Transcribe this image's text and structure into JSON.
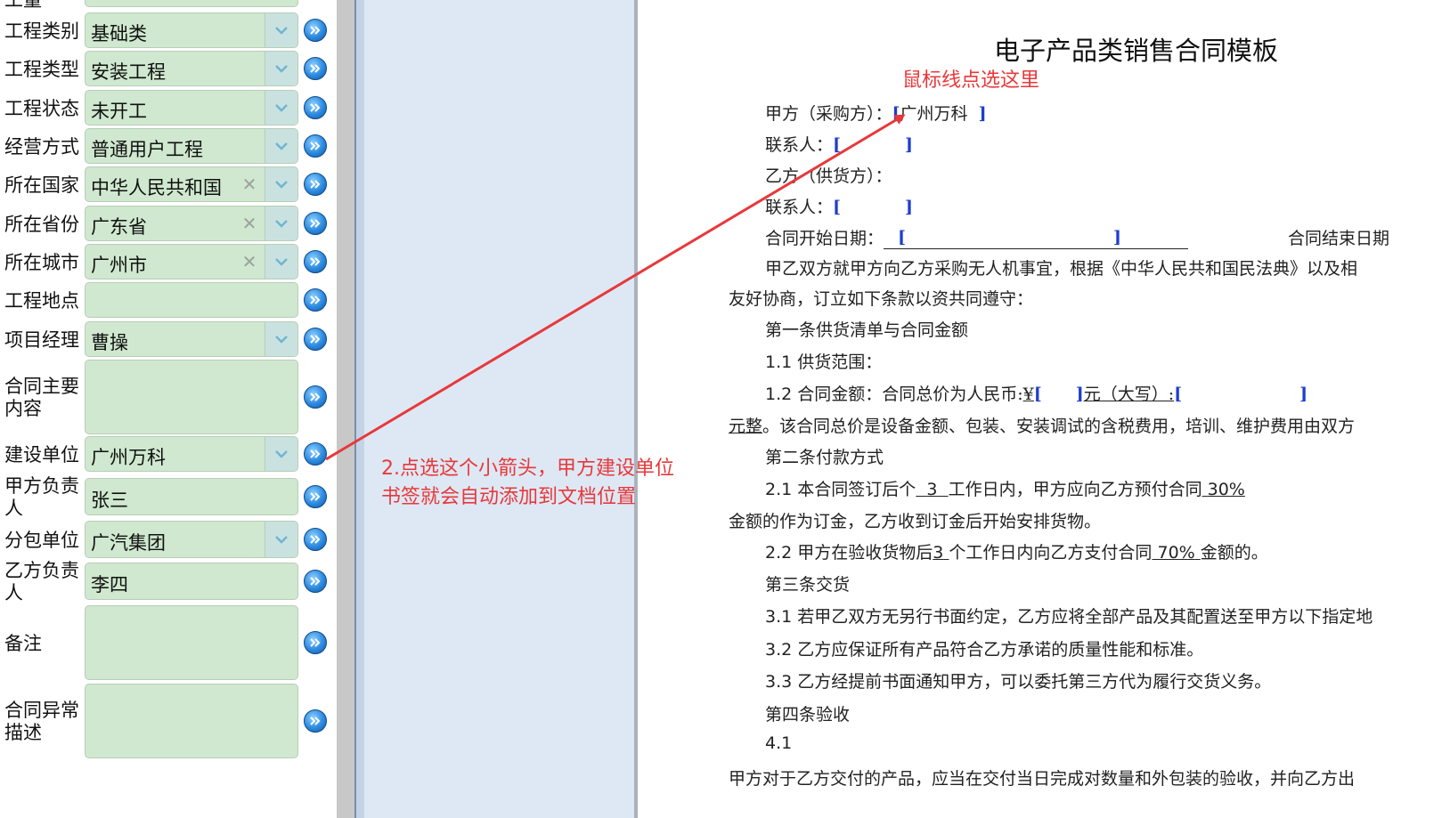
{
  "form": {
    "top_partial_label": "工量",
    "rows": [
      {
        "id": "project-category",
        "label": "工程类别",
        "value": "基础类",
        "dropdown": true,
        "clear": false
      },
      {
        "id": "project-type",
        "label": "工程类型",
        "value": "安装工程",
        "dropdown": true,
        "clear": false
      },
      {
        "id": "project-status",
        "label": "工程状态",
        "value": "未开工",
        "dropdown": true,
        "clear": false
      },
      {
        "id": "business-mode",
        "label": "经营方式",
        "value": "普通用户工程",
        "dropdown": true,
        "clear": false
      },
      {
        "id": "country",
        "label": "所在国家",
        "value": "中华人民共和国",
        "dropdown": true,
        "clear": true
      },
      {
        "id": "province",
        "label": "所在省份",
        "value": "广东省",
        "dropdown": true,
        "clear": true
      },
      {
        "id": "city",
        "label": "所在城市",
        "value": "广州市",
        "dropdown": true,
        "clear": true
      },
      {
        "id": "project-location",
        "label": "工程地点",
        "value": "",
        "dropdown": false,
        "clear": false
      },
      {
        "id": "project-manager",
        "label": "项目经理",
        "value": "曹操",
        "dropdown": true,
        "clear": false
      },
      {
        "id": "contract-main-content",
        "label": "合同主要内容",
        "value": "",
        "dropdown": false,
        "clear": false
      },
      {
        "id": "construction-unit",
        "label": "建设单位",
        "value": "广州万科",
        "dropdown": true,
        "clear": false
      },
      {
        "id": "party-a-person",
        "label": "甲方负责人",
        "value": "张三",
        "dropdown": false,
        "clear": false
      },
      {
        "id": "subcontract-unit",
        "label": "分包单位",
        "value": "广汽集团",
        "dropdown": true,
        "clear": false
      },
      {
        "id": "party-b-person",
        "label": "乙方负责人",
        "value": "李四",
        "dropdown": false,
        "clear": false
      },
      {
        "id": "remarks",
        "label": "备注",
        "value": "",
        "dropdown": false,
        "clear": false
      },
      {
        "id": "contract-exception",
        "label": "合同异常描述",
        "value": "",
        "dropdown": false,
        "clear": false
      }
    ]
  },
  "document": {
    "title": "电子产品类销售合同模板",
    "party_a_label": "甲方（采购方）：",
    "party_a_value": "广州万科",
    "contact1_label": "联系人：",
    "party_b_label": "乙方（供货方）：",
    "contact2_label": "联系人：",
    "start_date_label": "合同开始日期：",
    "end_date_label": "合同结束日期",
    "intro_1": "甲乙双方就甲方向乙方采购无人机事宜，根据《中华人民共和国民法典》以及相",
    "intro_2": "友好协商，订立如下条款以资共同遵守：",
    "art1": "第一条供货清单与合同金额",
    "s1_1_num": "1.1",
    "s1_1": "供货范围：",
    "s1_2_num": "1.2",
    "s1_2_a": "合同金额：合同总价为人民币:",
    "s1_2_yen": "¥",
    "s1_2_b": "元（大写）:",
    "s1_2_c1": "元整",
    "s1_2_c2": "。该合同总价是设备金额、包装、安装调试的含税费用，培训、维护费用由双方",
    "art2": "第二条付款方式",
    "s2_1_num": "2.1",
    "s2_1_a": "本合同签订后个",
    "s2_1_days": "3",
    "s2_1_b": "工作日内，甲方应向乙方预付合同",
    "s2_1_pct": "30%",
    "s2_1_c": "金额的作为订金，乙方收到订金后开始安排货物。",
    "s2_2_num": "2.2",
    "s2_2_a": "甲方在验收货物后",
    "s2_2_days": "3",
    "s2_2_b": "个工作日内向乙方支付合同",
    "s2_2_pct": "70%",
    "s2_2_c": "金额的。",
    "art3": "第三条交货",
    "s3_1_num": "3.1",
    "s3_1": "若甲乙双方无另行书面约定，乙方应将全部产品及其配置送至甲方以下指定地",
    "s3_2_num": "3.2",
    "s3_2": "乙方应保证所有产品符合乙方承诺的质量性能和标准。",
    "s3_3_num": "3.3",
    "s3_3": "乙方经提前书面通知甲方，可以委托第三方代为履行交货义务。",
    "art4": "第四条验收",
    "s4_1_num": "4.1",
    "s4_1": "甲方对于乙方交付的产品，应当在交付当日完成对数量和外包装的验收，并向乙方出"
  },
  "annotations": {
    "cursor_note": "鼠标线点选这里",
    "step2_line1": "2.点选这个小箭头，甲方建设单位",
    "step2_line2": "书签就会自动添加到文档位置",
    "arrow_color": "#e8383a"
  },
  "colors": {
    "field_bg": "#cfe8cf",
    "dropdown_bg": "#c9e2e0",
    "bookmark_blue": "#1e3ecf",
    "annotation_red": "#e8383a"
  },
  "icons": [
    "chevron-down-icon",
    "clear-x-icon",
    "double-chevron-right-icon"
  ]
}
